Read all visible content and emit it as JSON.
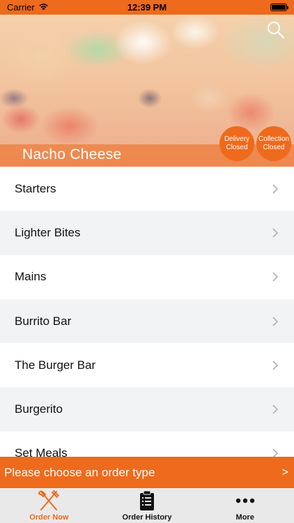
{
  "status_bar": {
    "carrier": "Carrier",
    "time": "12:39 PM",
    "battery_level": 1.0
  },
  "hero": {
    "restaurant_name": "Nacho Cheese",
    "search_icon": "search-icon",
    "badges": [
      {
        "line1": "Delivery",
        "line2": "Closed"
      },
      {
        "line1": "Collection",
        "line2": "Closed"
      }
    ]
  },
  "menu": {
    "categories": [
      {
        "label": "Starters"
      },
      {
        "label": "Lighter Bites"
      },
      {
        "label": "Mains"
      },
      {
        "label": "Burrito Bar"
      },
      {
        "label": "The Burger Bar"
      },
      {
        "label": "Burgerito"
      },
      {
        "label": "Set Meals"
      }
    ]
  },
  "order_bar": {
    "text": "Please choose an order type",
    "arrow": ">"
  },
  "tab_bar": {
    "tabs": [
      {
        "label": "Order Now",
        "icon": "fork-knife-icon",
        "active": true
      },
      {
        "label": "Order History",
        "icon": "clipboard-icon",
        "active": false
      },
      {
        "label": "More",
        "icon": "more-dots-icon",
        "active": false
      }
    ]
  },
  "colors": {
    "accent": "#ee6a1c",
    "alt_row": "#f2f3f5",
    "tab_bar_bg": "#e9e9e9"
  }
}
